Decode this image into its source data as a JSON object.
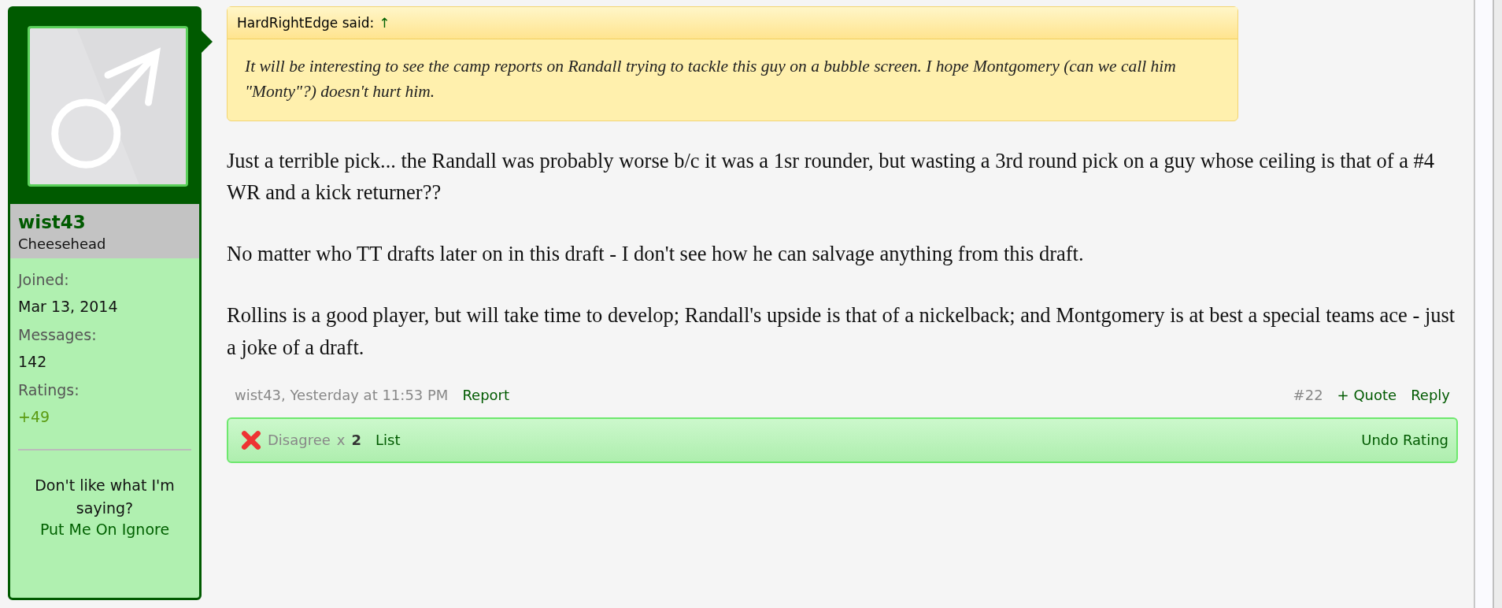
{
  "user": {
    "name": "wist43",
    "title": "Cheesehead",
    "stats": [
      {
        "label": "Joined:",
        "value": "Mar 13, 2014",
        "kind": "plain"
      },
      {
        "label": "Messages:",
        "value": "142",
        "kind": "plain"
      },
      {
        "label": "Ratings:",
        "value": "+49",
        "kind": "positive"
      }
    ],
    "ignore_text": "Don't like what I'm saying?",
    "ignore_link": "Put Me On Ignore"
  },
  "quote": {
    "author": "HardRightEdge said:",
    "arrow": "↑",
    "text": "It will be interesting to see the camp reports on Randall trying to tackle this guy on a bubble screen. I hope Montgomery (can we call him \"Monty\"?) doesn't hurt him."
  },
  "paragraphs": [
    "Just a terrible pick... the Randall was probably worse b/c it was a 1sr rounder, but wasting a 3rd round pick on a guy whose ceiling is that of a #4 WR and a kick returner??",
    "No matter who TT drafts later on in this draft - I don't see how he can salvage anything from this draft.",
    "Rollins is a good player, but will take time to develop; Randall's upside is that of a nickelback; and Montgomery is at best a special teams ace - just a joke of a draft."
  ],
  "footer": {
    "meta": "wist43, Yesterday at 11:53 PM",
    "report": "Report",
    "number": "#22",
    "quote": "+ Quote",
    "reply": "Reply"
  },
  "rating": {
    "label": "Disagree",
    "times": "x",
    "count": "2",
    "list": "List",
    "undo": "Undo Rating"
  }
}
